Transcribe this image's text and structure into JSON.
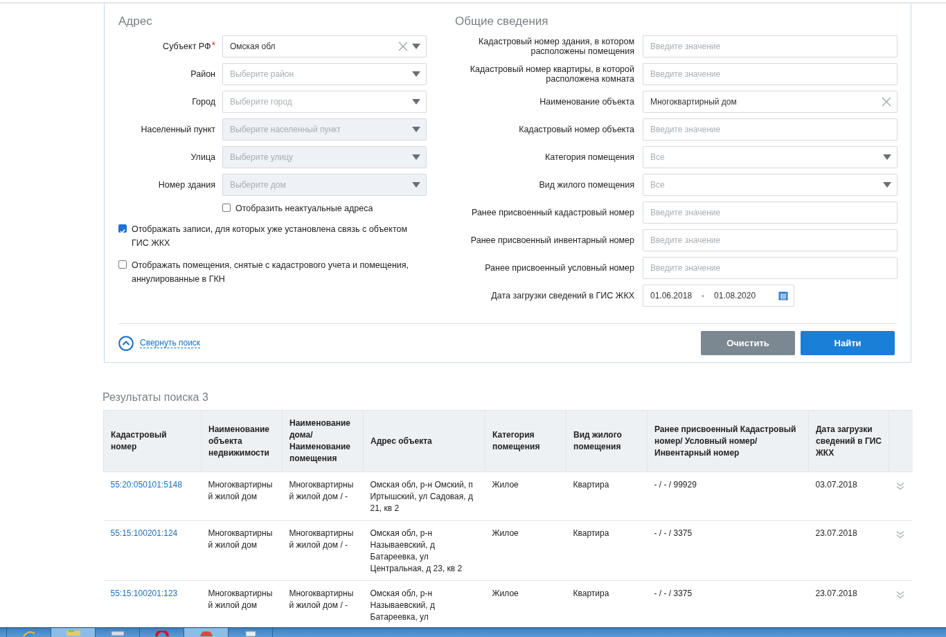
{
  "address": {
    "title": "Адрес",
    "fields": [
      {
        "label": "Субъект РФ",
        "required_mark": "*",
        "kind": "select",
        "value": "Омская обл",
        "clearable": true,
        "disabled": false
      },
      {
        "label": "Район",
        "kind": "select",
        "placeholder": "Выберите район",
        "clearable": false,
        "disabled": false
      },
      {
        "label": "Город",
        "kind": "select",
        "placeholder": "Выберите город",
        "clearable": false,
        "disabled": false
      },
      {
        "label": "Населенный пункт",
        "kind": "select",
        "placeholder": "Выберите населенный пункт",
        "clearable": false,
        "disabled": true
      },
      {
        "label": "Улица",
        "kind": "select",
        "placeholder": "Выберите улицу",
        "clearable": false,
        "disabled": true
      },
      {
        "label": "Номер здания",
        "kind": "select",
        "placeholder": "Выберите дом",
        "clearable": false,
        "disabled": true
      }
    ],
    "outdated": {
      "label": "Отобразить неактуальные адреса",
      "checked": false
    },
    "options": [
      {
        "label": "Отображать записи, для которых уже установлена связь с объектом ГИС ЖКХ",
        "checked": true
      },
      {
        "label": "Отображать помещения, снятые с кадастрового учета и помещения, аннулированные в ГКН",
        "checked": false
      }
    ]
  },
  "general": {
    "title": "Общие сведения",
    "fields": [
      {
        "label": "Кадастровый номер здания, в котором расположены помещения",
        "kind": "text",
        "placeholder": "Введите значение",
        "clearable": false
      },
      {
        "label": "Кадастровый номер квартиры, в которой расположена комната",
        "kind": "text",
        "placeholder": "Введите значение",
        "clearable": false
      },
      {
        "label": "Наименование объекта",
        "kind": "text",
        "value": "Многоквартирный дом",
        "clearable": true
      },
      {
        "label": "Кадастровый номер объекта",
        "kind": "text",
        "placeholder": "Введите значение",
        "clearable": false
      },
      {
        "label": "Категория помещения",
        "kind": "select",
        "placeholder": "Все",
        "clearable": false
      },
      {
        "label": "Вид жилого помещения",
        "kind": "select",
        "placeholder": "Все",
        "clearable": false
      },
      {
        "label": "Ранее присвоенный кадастровый номер",
        "kind": "text",
        "placeholder": "Введите значение",
        "clearable": false
      },
      {
        "label": "Ранее присвоенный инвентарный номер",
        "kind": "text",
        "placeholder": "Введите значение",
        "clearable": false
      },
      {
        "label": "Ранее присвоенный условный номер",
        "kind": "text",
        "placeholder": "Введите значение",
        "clearable": false
      },
      {
        "label": "Дата загрузки сведений в ГИС ЖКХ",
        "kind": "daterange",
        "from": "01.06.2018",
        "separator": "-",
        "to": "01.08.2020"
      }
    ]
  },
  "collapse_link": "Свернуть поиск",
  "buttons": [
    {
      "label": "Очистить",
      "kind": "secondary"
    },
    {
      "label": "Найти",
      "kind": "primary"
    }
  ],
  "results": {
    "title": "Результаты поиска 3",
    "columns": [
      "Кадастровый номер",
      "Наименование объекта недвижимости",
      "Наименование дома/ Наименование помещения",
      "Адрес объекта",
      "Категория помещения",
      "Вид жилого помещения",
      "Ранее присвоенный Кадастровый номер/ Условный номер/ Инвентарный номер",
      "Дата загрузки сведений в ГИС ЖКХ"
    ],
    "rows": [
      {
        "cells": [
          "55:20:050101:5148",
          "Многоквартирный жилой дом",
          "Многоквартирный жилой дом / -",
          "Омская обл, р-н Омский, п Иртышский, ул Садовая, д 21, кв 2",
          "Жилое",
          "Квартира",
          "- / - / 99929",
          "03.07.2018"
        ]
      },
      {
        "cells": [
          "55:15:100201:124",
          "Многоквартирный жилой дом",
          "Многоквартирный жилой дом / -",
          "Омская обл, р-н Называевский, д Батареевка, ул Центральная, д 23, кв 2",
          "Жилое",
          "Квартира",
          "- / - / 3375",
          "23.07.2018"
        ]
      },
      {
        "cells": [
          "55:15:100201:123",
          "Многоквартирный жилой дом",
          "Многоквартирный жилой дом / -",
          "Омская обл, р-н Называевский, д Батареевка, ул",
          "Жилое",
          "Квартира",
          "- / - / 3375",
          "23.07.2018"
        ]
      }
    ]
  },
  "taskbar": [
    {
      "kind": "start",
      "active": false
    },
    {
      "kind": "browser",
      "active": false
    },
    {
      "kind": "folder",
      "active": true
    },
    {
      "kind": "window",
      "active": false
    },
    {
      "kind": "opera",
      "active": false
    },
    {
      "kind": "red-app",
      "active": true
    },
    {
      "kind": "notepad",
      "active": false
    }
  ]
}
